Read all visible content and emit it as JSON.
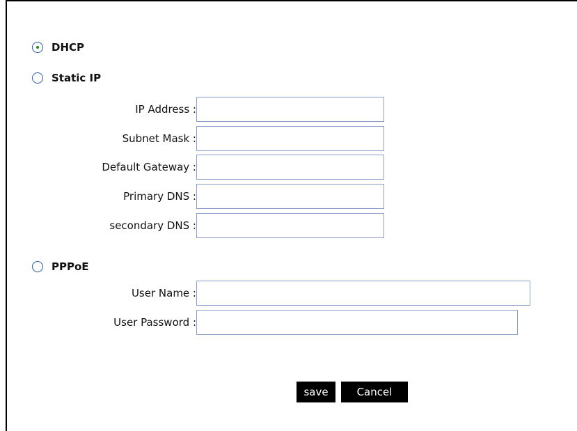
{
  "connection_types": {
    "dhcp": {
      "label": "DHCP",
      "checked": true
    },
    "static_ip": {
      "label": "Static IP",
      "checked": false
    },
    "pppoe": {
      "label": "PPPoE",
      "checked": false
    }
  },
  "static_fields": {
    "ip_address": {
      "label": "IP Address :",
      "value": ""
    },
    "subnet_mask": {
      "label": "Subnet Mask :",
      "value": ""
    },
    "default_gateway": {
      "label": "Default Gateway :",
      "value": ""
    },
    "primary_dns": {
      "label": "Primary DNS :",
      "value": ""
    },
    "secondary_dns": {
      "label": "secondary DNS :",
      "value": ""
    }
  },
  "pppoe_fields": {
    "user_name": {
      "label": "User Name :",
      "value": ""
    },
    "user_password": {
      "label": "User Password :",
      "value": ""
    }
  },
  "buttons": {
    "save": "save",
    "cancel": "Cancel"
  }
}
